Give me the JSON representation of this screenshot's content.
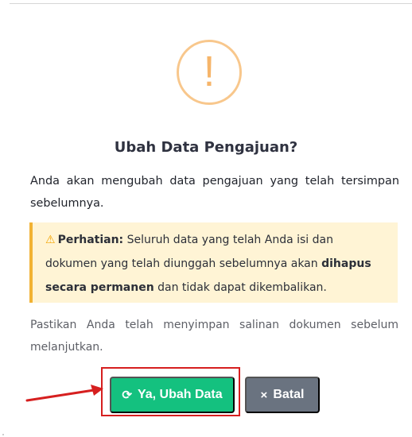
{
  "dialog": {
    "title": "Ubah Data Pengajuan?",
    "message": "Anda akan mengubah data pengajuan yang telah tersimpan sebelumnya.",
    "warning": {
      "icon_name": "warning-triangle-icon",
      "label": "Perhatian:",
      "text_1": " Seluruh data yang telah Anda isi dan dokumen yang telah diunggah sebelumnya akan ",
      "emphasis": "dihapus secara permanen",
      "text_2": " dan tidak dapat dikembalikan."
    },
    "footnote": "Pastikan Anda telah menyimpan salinan dokumen sebelum melanjutkan.",
    "buttons": {
      "confirm_label": "Ya, Ubah Data",
      "confirm_icon": "refresh-icon",
      "cancel_label": "Batal",
      "cancel_icon": "close-icon"
    }
  },
  "colors": {
    "warning_accent": "#f8c78c",
    "confirm_button": "#14c17f",
    "cancel_button": "#6a7380",
    "warning_box_background": "#fff4d5",
    "warning_box_border": "#f2b233",
    "annotation_red": "#d61f1f"
  }
}
